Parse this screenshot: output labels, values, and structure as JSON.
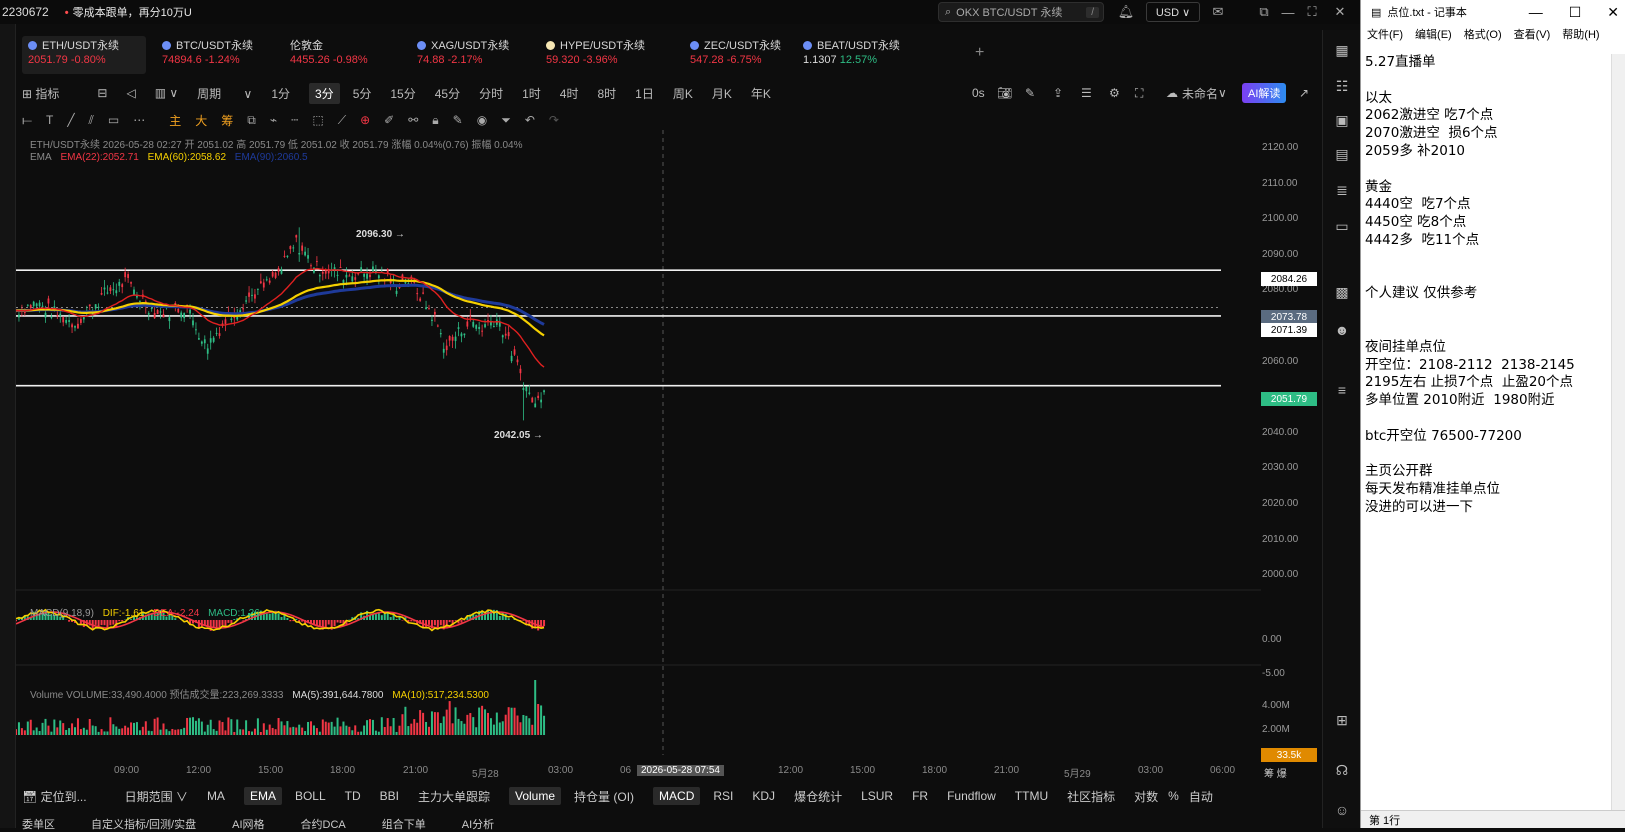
{
  "topbar": {
    "uid": "2230672",
    "promo_mark": "•",
    "promo": "零成本跟单，再分10万U",
    "search_placeholder": "OKX BTC/USDT 永续",
    "search_shortcut": "/",
    "currency": "USD ∨"
  },
  "tickers": [
    {
      "name": "ETH/USDT永续",
      "price": "2051.79",
      "change": "-0.80%",
      "dir": "dn",
      "dot": "#6c8ef5",
      "active": true
    },
    {
      "name": "BTC/USDT永续",
      "price": "74894.6",
      "change": "-1.24%",
      "dir": "dn",
      "dot": "#6c8ef5"
    },
    {
      "name": "伦敦金",
      "price": "4455.26",
      "change": "-0.98%",
      "dir": "dn",
      "dot": ""
    },
    {
      "name": "XAG/USDT永续",
      "price": "74.88",
      "change": "-2.17%",
      "dir": "dn",
      "dot": "#6c8ef5"
    },
    {
      "name": "HYPE/USDT永续",
      "price": "59.320",
      "change": "-3.96%",
      "dir": "dn",
      "dot": "#f5e6b3"
    },
    {
      "name": "ZEC/USDT永续",
      "price": "547.28",
      "change": "-6.75%",
      "dir": "dn",
      "dot": "#6c8ef5"
    },
    {
      "name": "BEAT/USDT永续",
      "price": "1.1307",
      "change": "12.57%",
      "dir": "up",
      "dot": "#6c8ef5"
    }
  ],
  "toolbar1": {
    "indicators": "指标",
    "period_label": "周期",
    "periods": [
      "1分",
      "3分",
      "5分",
      "15分",
      "45分",
      "分时",
      "1时",
      "4时",
      "8时",
      "1日",
      "周K",
      "月K",
      "年K"
    ],
    "selected": "3分",
    "countdown": "0s",
    "unnamed": "未命名",
    "ai": "AI解读"
  },
  "toolbar2": {
    "zhu": "主",
    "da": "大",
    "chou": "筹"
  },
  "chart_info": {
    "symbol_line": "ETH/USDT永续  2026-05-28 02:27  开 2051.02  高 2051.79  低 2051.02  收 2051.79  涨幅 0.04%(0.76)  振幅 0.04%",
    "ema_label": "EMA",
    "ema22": "EMA(22):2052.71",
    "ema60": "EMA(60):2058.62",
    "ema_extra": "EMA(90):2060.5",
    "macd_label": "MACD(9,18,9)",
    "dif": "DIF:-1.61",
    "dea": "DEA:-2.24",
    "macd": "MACD:1.26",
    "vol_label": "Volume  VOLUME:33,490.4000  预估成交量:223,269.3333",
    "ma5": "MA(5):391,644.7800",
    "ma10": "MA(10):517,234.5300",
    "high_label": "2096.30 →",
    "low_label": "2042.05 →"
  },
  "y_axis": [
    "2120.00",
    "2110.00",
    "2100.00",
    "2090.00",
    "2080.00",
    "2070.00",
    "2060.00",
    "2050.00",
    "2040.00",
    "2030.00",
    "2020.00",
    "2010.00",
    "2000.00"
  ],
  "price_tags": {
    "l1": "2084.26",
    "l2": "2073.78",
    "l3": "2071.39",
    "cur": "2051.79"
  },
  "macd_axis": [
    "0.00",
    "-5.00"
  ],
  "vol_axis": [
    "4.00M",
    "2.00M",
    "33.5k"
  ],
  "x_axis": [
    "09:00",
    "12:00",
    "15:00",
    "18:00",
    "21:00",
    "5月28",
    "03:00",
    "06",
    "2026-05-28 07:54",
    "12:00",
    "15:00",
    "18:00",
    "21:00",
    "5月29",
    "03:00",
    "06:00"
  ],
  "axis_corner": "筹  爆",
  "bottombar": {
    "locate": "定位到...",
    "date_range": "日期范围 ∨",
    "main": [
      "MA",
      "EMA",
      "BOLL",
      "TD",
      "BBI",
      "主力大单跟踪"
    ],
    "main_sel": "EMA",
    "sub": [
      "Volume",
      "持仓量 (OI)",
      "MACD",
      "RSI",
      "KDJ",
      "爆仓统计",
      "LSUR",
      "FR",
      "Fundflow",
      "TTMU"
    ],
    "community": "社区指标",
    "compare": "对数",
    "pct": "%",
    "auto": "自动"
  },
  "bottom2": [
    "委单区",
    "自定义指标/回测/实盘",
    "AI网格",
    "合约DCA",
    "组合下单",
    "AI分析"
  ],
  "notepad": {
    "title": "点位.txt - 记事本",
    "menu": [
      "文件(F)",
      "编辑(E)",
      "格式(O)",
      "查看(V)",
      "帮助(H)"
    ],
    "content": "5.27直播单\n\n以太\n2062激进空 吃7个点\n2070激进空  损6个点\n2059多 补2010\n\n黄金\n4440空  吃7个点\n4450空 吃8个点\n4442多  吃11个点\n\n\n个人建议 仅供参考\n\n\n夜间挂单点位\n开空位：2108-2112  2138-2145\n2195左右 止损7个点  止盈20个点\n多单位置 2010附近  1980附近\n\nbtc开空位 76500-77200\n\n主页公开群\n每天发布精准挂单点位\n没进的可以进一下",
    "status": "第 1行"
  }
}
